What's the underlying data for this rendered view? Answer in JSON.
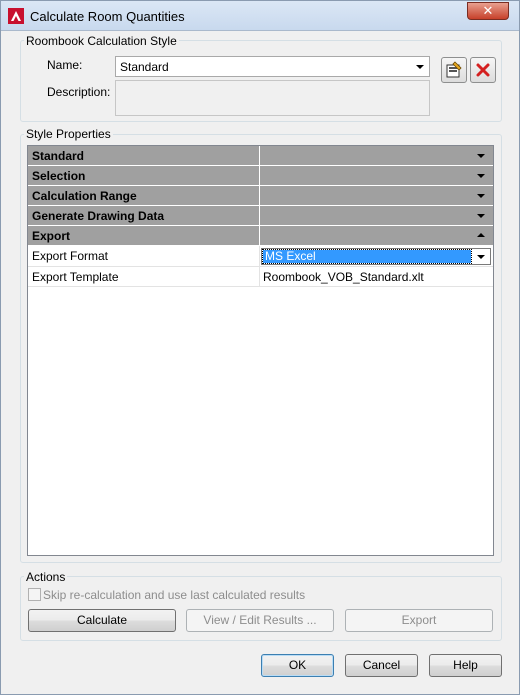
{
  "window": {
    "title": "Calculate Room Quantities",
    "close_glyph": "✕"
  },
  "style_group": {
    "label": "Roombook Calculation Style",
    "name_label": "Name:",
    "name_value": "Standard",
    "description_label": "Description:",
    "description_value": ""
  },
  "properties": {
    "label": "Style Properties",
    "categories": [
      {
        "label": "Standard",
        "expanded": false
      },
      {
        "label": "Selection",
        "expanded": false
      },
      {
        "label": "Calculation Range",
        "expanded": false
      },
      {
        "label": "Generate Drawing Data",
        "expanded": false
      },
      {
        "label": "Export",
        "expanded": true
      }
    ],
    "rows": [
      {
        "label": "Export Format",
        "value": "MS Excel"
      },
      {
        "label": "Export Template",
        "value": "Roombook_VOB_Standard.xlt"
      }
    ]
  },
  "actions": {
    "label": "Actions",
    "skip_label": "Skip re-calculation and use last calculated results",
    "skip_checked": false,
    "calculate_label": "Calculate",
    "view_edit_label": "View / Edit Results ...",
    "export_label": "Export"
  },
  "footer": {
    "ok_label": "OK",
    "cancel_label": "Cancel",
    "help_label": "Help"
  },
  "colors": {
    "category_bg": "#a0a0a0",
    "selection": "#3399ff",
    "delete_icon": "#d42020"
  }
}
